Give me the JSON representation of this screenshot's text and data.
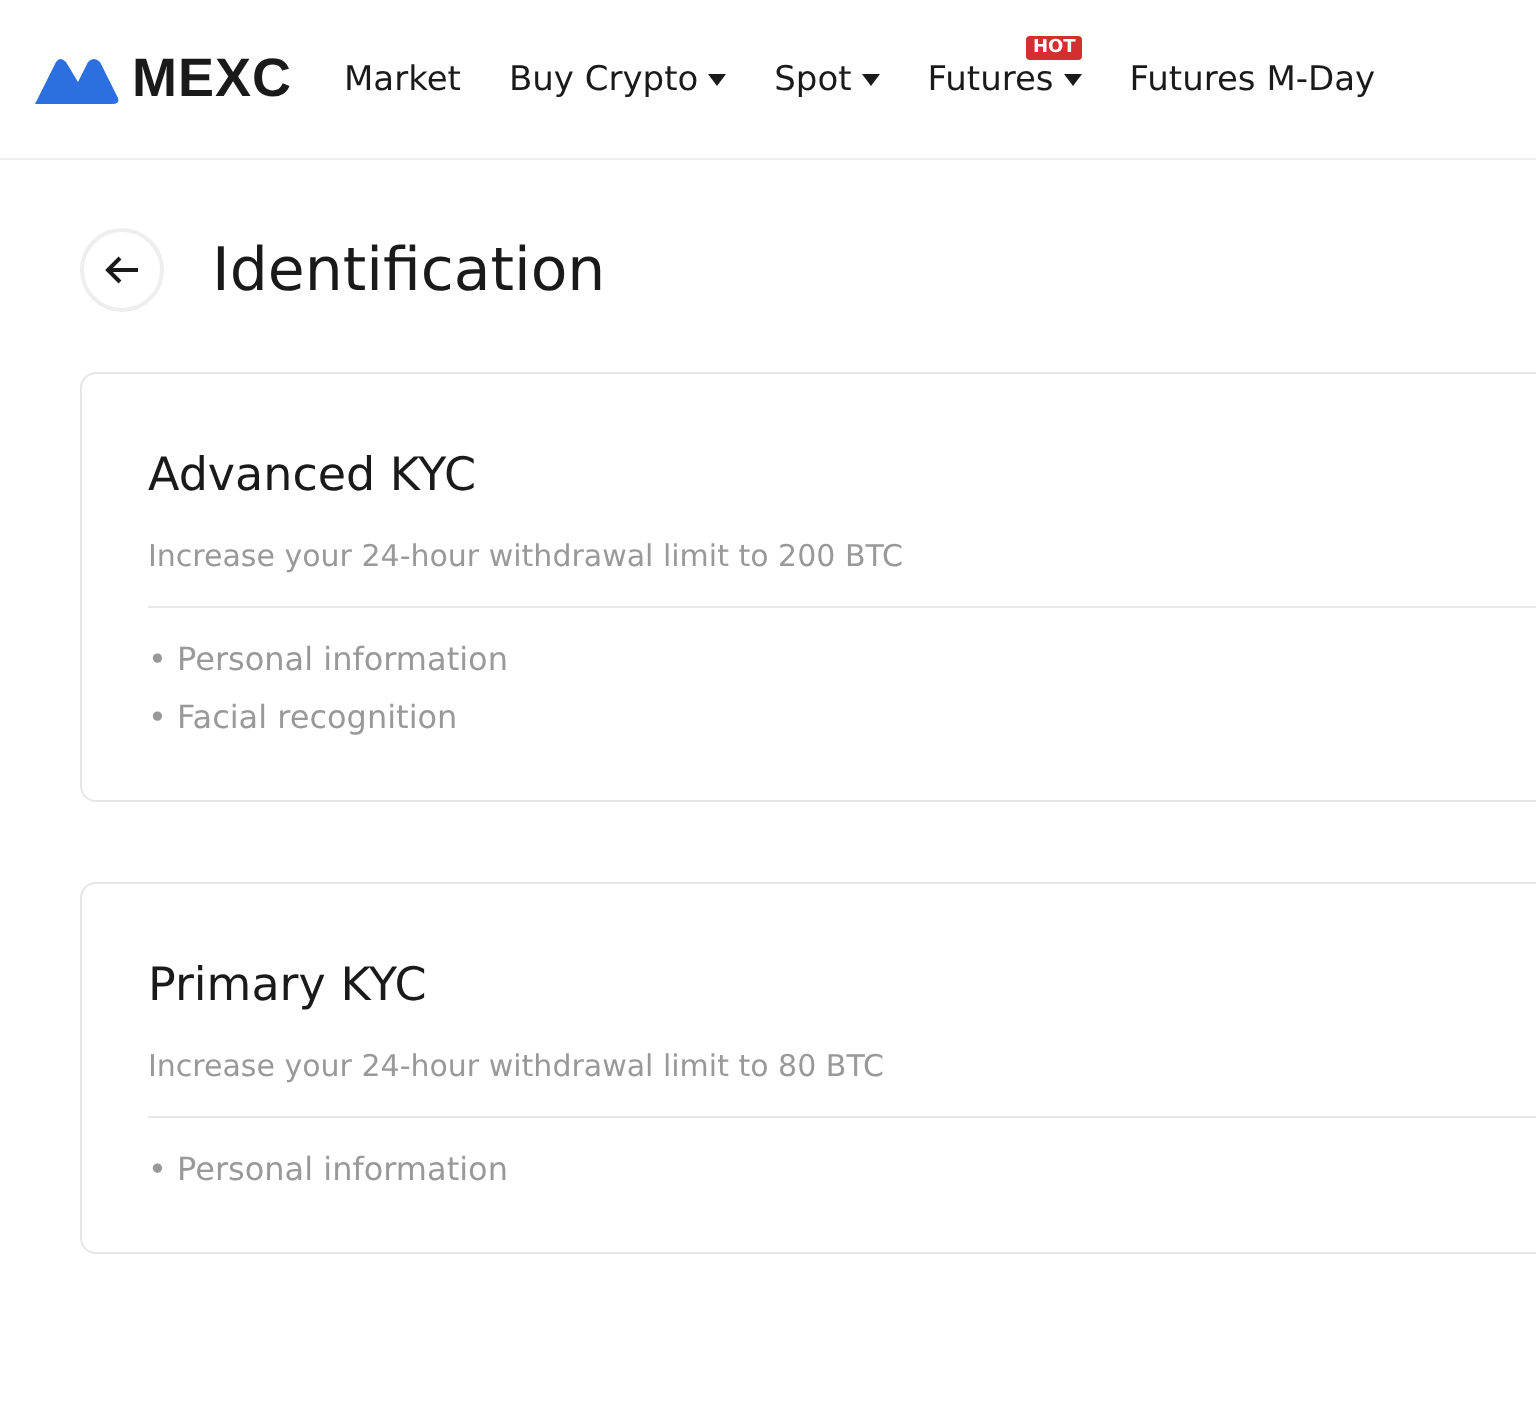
{
  "header": {
    "logo": "MEXC",
    "nav": [
      {
        "label": "Market",
        "dropdown": false
      },
      {
        "label": "Buy Crypto",
        "dropdown": true
      },
      {
        "label": "Spot",
        "dropdown": true
      },
      {
        "label": "Futures",
        "dropdown": true,
        "badge": "HOT"
      },
      {
        "label": "Futures M-Day",
        "dropdown": false
      }
    ]
  },
  "page": {
    "title": "Identification"
  },
  "cards": [
    {
      "title": "Advanced KYC",
      "description": "Increase your 24-hour withdrawal limit to 200 BTC",
      "items": [
        "• Personal information",
        "• Facial recognition"
      ]
    },
    {
      "title": "Primary KYC",
      "description": "Increase your 24-hour withdrawal limit to 80 BTC",
      "items": [
        "• Personal information"
      ]
    }
  ]
}
